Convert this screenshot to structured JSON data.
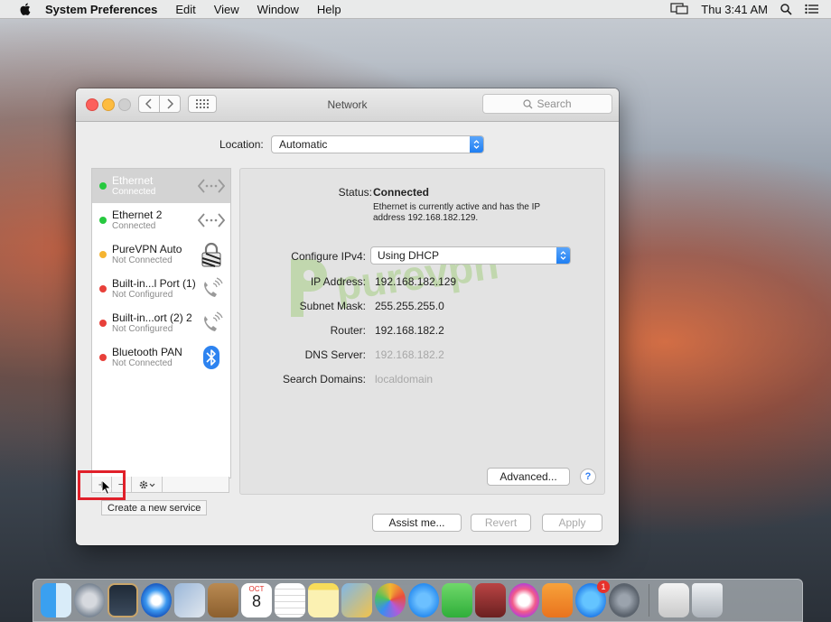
{
  "menubar": {
    "app_name": "System Preferences",
    "items": [
      "Edit",
      "View",
      "Window",
      "Help"
    ],
    "clock": "Thu 3:41 AM"
  },
  "window": {
    "title": "Network",
    "search_placeholder": "Search",
    "location_label": "Location:",
    "location_value": "Automatic"
  },
  "services": [
    {
      "name": "Ethernet",
      "state": "Connected",
      "status_color": "#27c93f",
      "icon": "ethernet-icon",
      "selected": true
    },
    {
      "name": "Ethernet 2",
      "state": "Connected",
      "status_color": "#27c93f",
      "icon": "ethernet-icon",
      "selected": false
    },
    {
      "name": "PureVPN Auto",
      "state": "Not Connected",
      "status_color": "#f5b431",
      "icon": "vpn-lock-icon",
      "selected": false
    },
    {
      "name": "Built-in...l Port (1)",
      "state": "Not Configured",
      "status_color": "#e8403a",
      "icon": "phone-icon",
      "selected": false
    },
    {
      "name": "Built-in...ort (2) 2",
      "state": "Not Configured",
      "status_color": "#e8403a",
      "icon": "phone-icon",
      "selected": false
    },
    {
      "name": "Bluetooth PAN",
      "state": "Not Connected",
      "status_color": "#e8403a",
      "icon": "bluetooth-icon",
      "selected": false
    }
  ],
  "list_toolbar": {
    "add_label": "+",
    "remove_label": "−",
    "tooltip": "Create a new service"
  },
  "detail": {
    "status_label": "Status:",
    "status_value": "Connected",
    "status_desc": "Ethernet is currently active and has the IP address 192.168.182.129.",
    "configure_label": "Configure IPv4:",
    "configure_value": "Using DHCP",
    "ip_label": "IP Address:",
    "ip_value": "192.168.182.129",
    "subnet_label": "Subnet Mask:",
    "subnet_value": "255.255.255.0",
    "router_label": "Router:",
    "router_value": "192.168.182.2",
    "dns_label": "DNS Server:",
    "dns_value": "192.168.182.2",
    "search_domains_label": "Search Domains:",
    "search_domains_value": "localdomain",
    "watermark": "purevpn",
    "advanced_label": "Advanced...",
    "help_label": "?"
  },
  "buttons": {
    "assist": "Assist me...",
    "revert": "Revert",
    "apply": "Apply"
  },
  "dock": {
    "calendar_month": "OCT",
    "calendar_day": "8",
    "appstore_badge": "1"
  }
}
